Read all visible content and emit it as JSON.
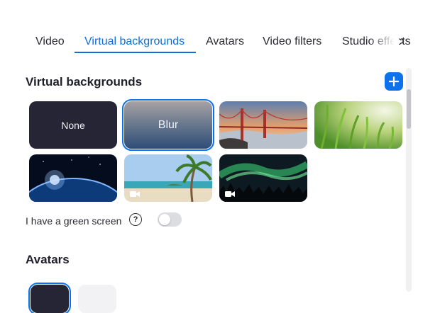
{
  "tabs": [
    {
      "label": "Video",
      "active": false
    },
    {
      "label": "Virtual backgrounds",
      "active": true
    },
    {
      "label": "Avatars",
      "active": false
    },
    {
      "label": "Video filters",
      "active": false
    },
    {
      "label": "Studio effects",
      "active": false
    }
  ],
  "sections": {
    "virtual_backgrounds": "Virtual backgrounds",
    "avatars": "Avatars"
  },
  "tiles": [
    {
      "label": "None",
      "selected": false
    },
    {
      "label": "Blur",
      "selected": true
    },
    {
      "label": "",
      "image": "golden-gate-bridge"
    },
    {
      "label": "",
      "image": "green-grass"
    },
    {
      "label": "",
      "image": "earth-from-space"
    },
    {
      "label": "",
      "image": "beach-palm",
      "video": true
    },
    {
      "label": "",
      "image": "aurora",
      "video": true
    }
  ],
  "green_screen": {
    "label": "I have a green screen",
    "enabled": false
  },
  "icons": {
    "add": "plus-icon",
    "help": "help-icon",
    "next": "chevron-right-icon",
    "video": "video-camera-icon"
  },
  "colors": {
    "accent": "#0e72ed",
    "tile_dark": "#252536"
  }
}
